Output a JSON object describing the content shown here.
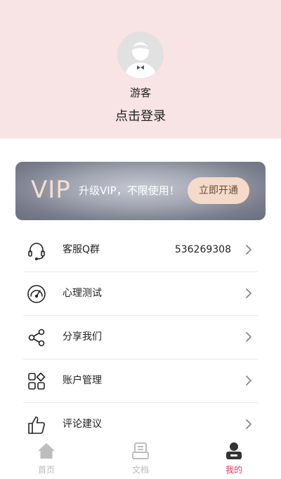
{
  "profile": {
    "username": "游客",
    "login_text": "点击登录"
  },
  "vip": {
    "logo": "VIP",
    "text": "升级VIP，不限使用！",
    "button": "立即开通"
  },
  "menu": {
    "items": [
      {
        "icon": "headset-icon",
        "label": "客服Q群",
        "value": "536269308"
      },
      {
        "icon": "gauge-icon",
        "label": "心理测试",
        "value": ""
      },
      {
        "icon": "share-icon",
        "label": "分享我们",
        "value": ""
      },
      {
        "icon": "grid-icon",
        "label": "账户管理",
        "value": ""
      },
      {
        "icon": "thumbs-up-icon",
        "label": "评论建议",
        "value": ""
      }
    ]
  },
  "tabs": [
    {
      "icon": "home-icon",
      "label": "首页",
      "active": false
    },
    {
      "icon": "document-icon",
      "label": "文档",
      "active": false
    },
    {
      "icon": "profile-icon",
      "label": "我的",
      "active": true
    }
  ],
  "colors": {
    "header_bg": "#f8e3e5",
    "vip_gold": "#f3dfcf",
    "vip_button_bg": "#f4dbc9",
    "active_tab": "#e03a5c",
    "inactive_tab": "#b9b9b9"
  }
}
